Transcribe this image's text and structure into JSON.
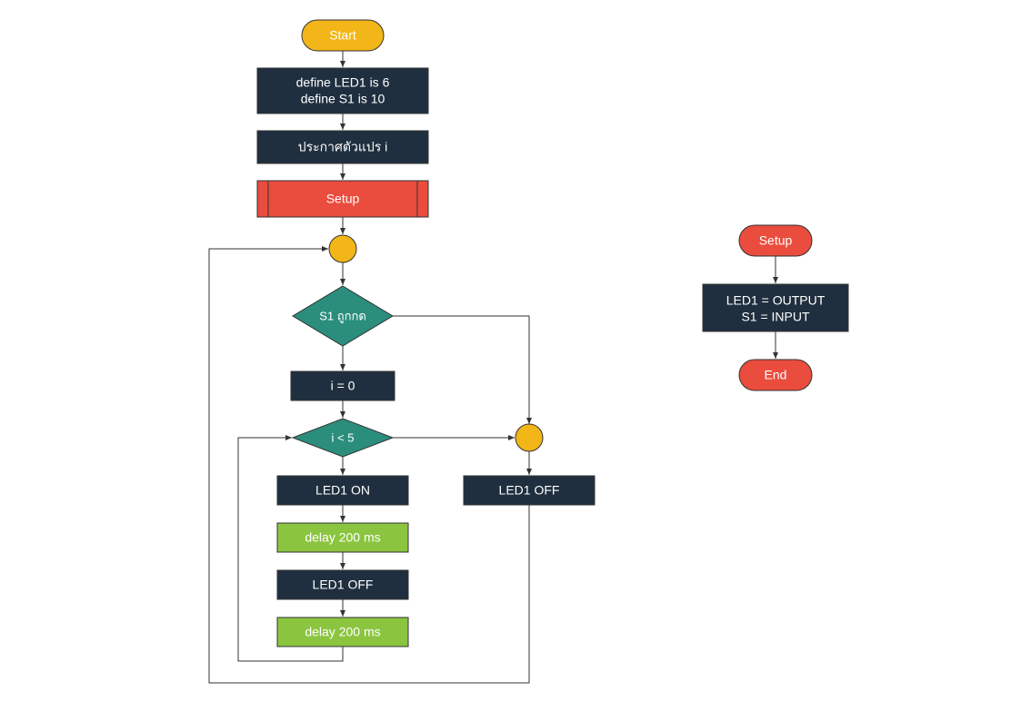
{
  "flowchart": {
    "start": "Start",
    "define": {
      "line1": "define LED1 is 6",
      "line2": "define S1 is 10"
    },
    "declare_var": "ประกาศตัวแปร i",
    "setup_call": "Setup",
    "decision_s1": "S1 ถูกกด",
    "set_i": "i = 0",
    "decision_i5": "i < 5",
    "led1_on": "LED1 ON",
    "delay1": "delay 200 ms",
    "led1_off_loop": "LED1 OFF",
    "delay2": "delay 200 ms",
    "led1_off_right": "LED1 OFF"
  },
  "setup_sub": {
    "start": "Setup",
    "body": {
      "line1": "LED1 = OUTPUT",
      "line2": "S1 = INPUT"
    },
    "end": "End"
  },
  "colors": {
    "orange": "#f2b619",
    "darkblue": "#1f2f3f",
    "red": "#ea4d3d",
    "teal": "#2b8e7c",
    "green": "#8bc53f",
    "stroke": "#333333"
  }
}
